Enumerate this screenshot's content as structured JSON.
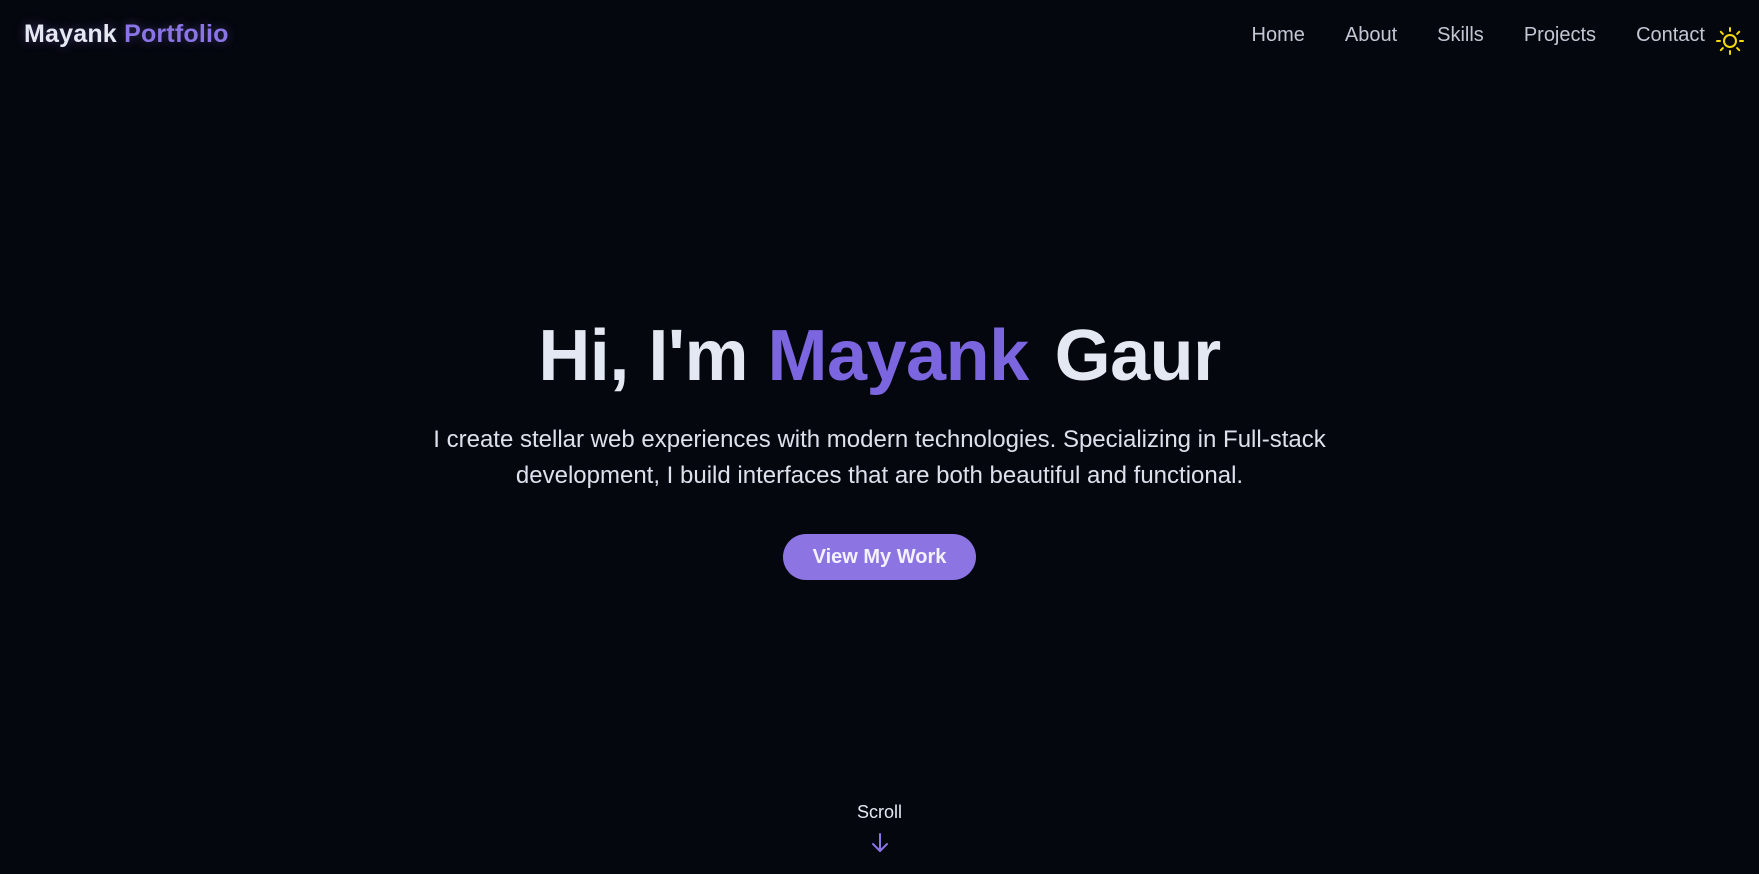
{
  "header": {
    "logo_first": "Mayank",
    "logo_second": "Portfolio",
    "nav": {
      "home": "Home",
      "about": "About",
      "skills": "Skills",
      "projects": "Projects",
      "contact": "Contact"
    },
    "theme_icon": "sun-icon"
  },
  "hero": {
    "greeting": "Hi, I'm",
    "first_name": "Mayank",
    "last_name": "Gaur",
    "subtitle": "I create stellar web experiences with modern technologies. Specializing in Full-stack development, I build interfaces that are both beautiful and functional.",
    "cta_label": "View My Work"
  },
  "scroll": {
    "label": "Scroll",
    "icon": "arrow-down-icon"
  },
  "colors": {
    "background": "#05070f",
    "accent": "#7c66e0",
    "button": "#8c74e3",
    "sun": "#f5d90a"
  }
}
